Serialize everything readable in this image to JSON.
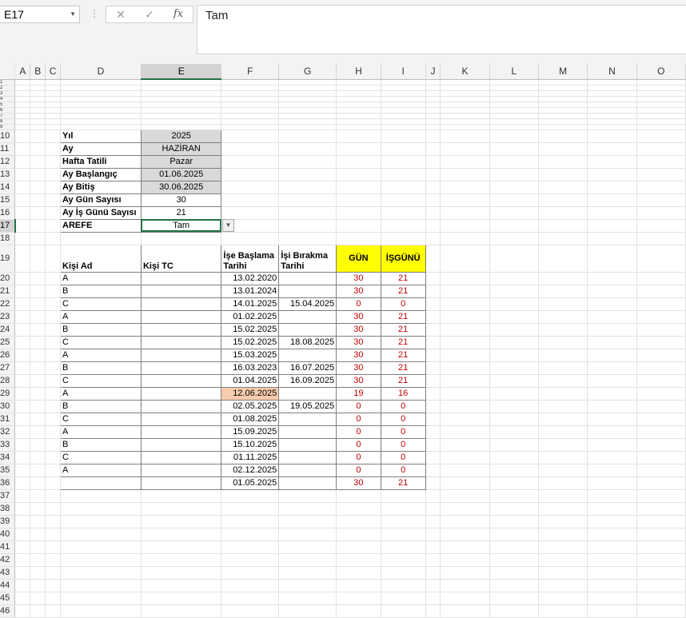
{
  "formula_bar": {
    "name_box": "E17",
    "separator": "⋮",
    "cancel_icon": "✕",
    "enter_icon": "✓",
    "fx_label": "fx",
    "value": "Tam"
  },
  "columns": [
    "A",
    "B",
    "C",
    "D",
    "E",
    "F",
    "G",
    "H",
    "I",
    "J",
    "K",
    "L",
    "M",
    "N",
    "O"
  ],
  "selected_column": "E",
  "selected_row": 17,
  "params": [
    {
      "row": 10,
      "label": "Yıl",
      "value": "2025"
    },
    {
      "row": 11,
      "label": "Ay",
      "value": "HAZİRAN"
    },
    {
      "row": 12,
      "label": "Hafta Tatili",
      "value": "Pazar"
    },
    {
      "row": 13,
      "label": "Ay Başlangıç",
      "value": "01.06.2025"
    },
    {
      "row": 14,
      "label": "Ay Bitiş",
      "value": "30.06.2025"
    },
    {
      "row": 15,
      "label": "Ay Gün Sayısı",
      "value": "30"
    },
    {
      "row": 16,
      "label": "Ay İş Günü Sayısı",
      "value": "21"
    },
    {
      "row": 17,
      "label": "AREFE",
      "value": "Tam"
    }
  ],
  "table_headers": {
    "name": "Kişi Ad",
    "tc": "Kişi TC",
    "start": "İşe Başlama Tarihi",
    "end": "İşi Bırakma Tarihi",
    "days": "GÜN",
    "workdays": "İŞGÜNÜ"
  },
  "table_rows": [
    {
      "row": 20,
      "name": "A",
      "tc": "",
      "start": "13.02.2020",
      "end": "",
      "days": "30",
      "workdays": "21"
    },
    {
      "row": 21,
      "name": "B",
      "tc": "",
      "start": "13.01.2024",
      "end": "",
      "days": "30",
      "workdays": "21"
    },
    {
      "row": 22,
      "name": "C",
      "tc": "",
      "start": "14.01.2025",
      "end": "15.04.2025",
      "days": "0",
      "workdays": "0"
    },
    {
      "row": 23,
      "name": "A",
      "tc": "",
      "start": "01.02.2025",
      "end": "",
      "days": "30",
      "workdays": "21"
    },
    {
      "row": 24,
      "name": "B",
      "tc": "",
      "start": "15.02.2025",
      "end": "",
      "days": "30",
      "workdays": "21"
    },
    {
      "row": 25,
      "name": "C",
      "tc": "",
      "start": "15.02.2025",
      "end": "18.08.2025",
      "days": "30",
      "workdays": "21"
    },
    {
      "row": 26,
      "name": "A",
      "tc": "",
      "start": "15.03.2025",
      "end": "",
      "days": "30",
      "workdays": "21"
    },
    {
      "row": 27,
      "name": "B",
      "tc": "",
      "start": "16.03.2023",
      "end": "16.07.2025",
      "days": "30",
      "workdays": "21"
    },
    {
      "row": 28,
      "name": "C",
      "tc": "",
      "start": "01.04.2025",
      "end": "16.09.2025",
      "days": "30",
      "workdays": "21"
    },
    {
      "row": 29,
      "name": "A",
      "tc": "",
      "start": "12.06.2025",
      "end": "",
      "days": "19",
      "workdays": "16",
      "highlight": true
    },
    {
      "row": 30,
      "name": "B",
      "tc": "",
      "start": "02.05.2025",
      "end": "19.05.2025",
      "days": "0",
      "workdays": "0"
    },
    {
      "row": 31,
      "name": "C",
      "tc": "",
      "start": "01.08.2025",
      "end": "",
      "days": "0",
      "workdays": "0"
    },
    {
      "row": 32,
      "name": "A",
      "tc": "",
      "start": "15.09.2025",
      "end": "",
      "days": "0",
      "workdays": "0"
    },
    {
      "row": 33,
      "name": "B",
      "tc": "",
      "start": "15.10.2025",
      "end": "",
      "days": "0",
      "workdays": "0"
    },
    {
      "row": 34,
      "name": "C",
      "tc": "",
      "start": "01.11.2025",
      "end": "",
      "days": "0",
      "workdays": "0"
    },
    {
      "row": 35,
      "name": "A",
      "tc": "",
      "start": "02.12.2025",
      "end": "",
      "days": "0",
      "workdays": "0"
    },
    {
      "row": 36,
      "name": "",
      "tc": "",
      "start": "01.05.2025",
      "end": "",
      "days": "30",
      "workdays": "21"
    }
  ],
  "colors": {
    "accent": "#217346",
    "param_fill": "#d9d9d9",
    "header_highlight": "#ffff00",
    "row_highlight": "#f8cbad",
    "value_red": "#c00000"
  }
}
